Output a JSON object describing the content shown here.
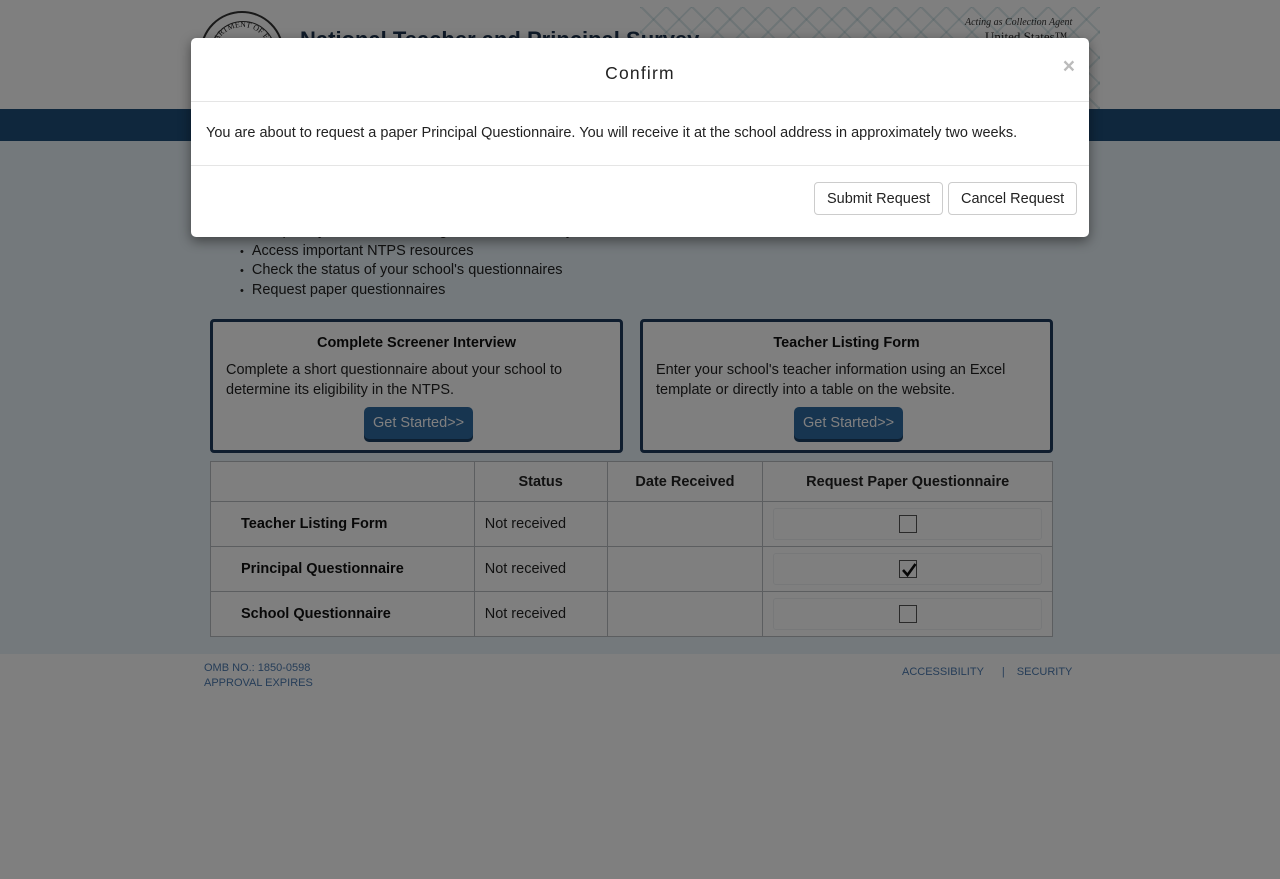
{
  "header": {
    "seal_text": "DEPARTMENT OF EDUCATION",
    "title": "National Teacher and Principal Survey",
    "agent_text": "Acting as Collection Agent",
    "census_text": "United States™"
  },
  "intro_list": [
    "Complete your Teacher Listing Form electronically",
    "Access important NTPS resources",
    "Check the status of your school's questionnaires",
    "Request paper questionnaires"
  ],
  "cards": [
    {
      "title": "Complete Screener Interview",
      "description": "Complete a short questionnaire about your school to determine its eligibility in the NTPS.",
      "button_label": "Get Started>>"
    },
    {
      "title": "Teacher Listing Form",
      "description": "Enter your school's teacher information using an Excel template or directly into a table on the website.",
      "button_label": "Get Started>>"
    }
  ],
  "status_table": {
    "columns": [
      "",
      "Status",
      "Date Received",
      "Request Paper Questionnaire"
    ],
    "rows": [
      {
        "name": "Teacher Listing Form",
        "status": "Not received",
        "date_received": "",
        "requested": false
      },
      {
        "name": "Principal Questionnaire",
        "status": "Not received",
        "date_received": "",
        "requested": true
      },
      {
        "name": "School Questionnaire",
        "status": "Not received",
        "date_received": "",
        "requested": false
      }
    ]
  },
  "footer": {
    "omb_line1": "OMB NO.: 1850-0598",
    "omb_line2": "APPROVAL EXPIRES",
    "accessibility": "ACCESSIBILITY",
    "separator": "|",
    "security": "SECURITY"
  },
  "modal": {
    "title": "Confirm",
    "close_symbol": "×",
    "message": "You are about to request a paper Principal Questionnaire. You will receive it at the school address in approximately two weeks.",
    "submit_label": "Submit Request",
    "cancel_label": "Cancel Request"
  },
  "colors": {
    "nav_bar": "#1f4f7a",
    "card_border": "#1f3a5c",
    "button_blue": "#2f6aa1",
    "main_background": "#e8f3f9",
    "link": "#4c7bb0"
  }
}
